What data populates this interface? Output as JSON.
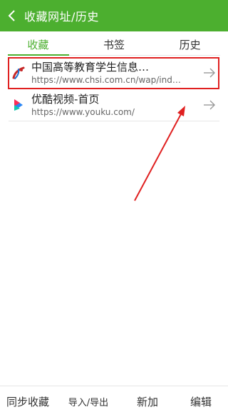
{
  "header": {
    "title": "收藏网址/历史"
  },
  "tabs": [
    {
      "label": "收藏",
      "active": true
    },
    {
      "label": "书签",
      "active": false
    },
    {
      "label": "历史",
      "active": false
    }
  ],
  "bookmarks": [
    {
      "title": "中国高等教育学生信息…",
      "url": "https://www.chsi.com.cn/wap/ind…",
      "icon": "chsi-logo-icon",
      "highlighted": true
    },
    {
      "title": "优酷视频-首页",
      "url": "https://www.youku.com/",
      "icon": "youku-logo-icon",
      "highlighted": false
    }
  ],
  "footer": {
    "sync": "同步收藏",
    "import_export": "导入/导出",
    "add": "新加",
    "edit": "编辑"
  },
  "colors": {
    "accent": "#4caf2f",
    "annotation": "#e02020"
  }
}
